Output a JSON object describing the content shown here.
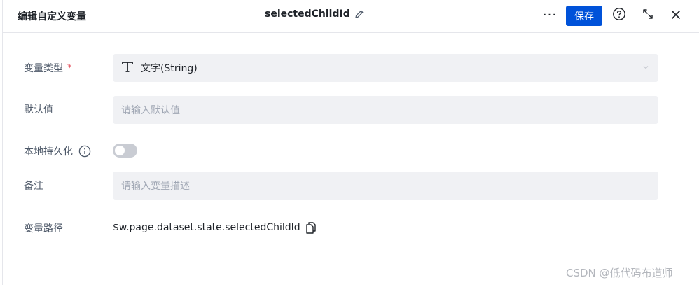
{
  "header": {
    "left_title": "编辑自定义变量",
    "center_title": "selectedChildId",
    "more_label": "···",
    "save_label": "保存"
  },
  "form": {
    "type": {
      "label": "变量类型",
      "required_mark": "*",
      "value": "文字(String)"
    },
    "default": {
      "label": "默认值",
      "placeholder": "请输入默认值"
    },
    "persist": {
      "label": "本地持久化",
      "enabled": false
    },
    "note": {
      "label": "备注",
      "placeholder": "请输入变量描述"
    },
    "path": {
      "label": "变量路径",
      "value": "$w.page.dataset.state.selectedChildId"
    }
  },
  "watermark": "CSDN @低代码布道师",
  "colors": {
    "primary": "#0052d9",
    "field_bg": "#f0f1f4",
    "required": "#e34d59"
  }
}
